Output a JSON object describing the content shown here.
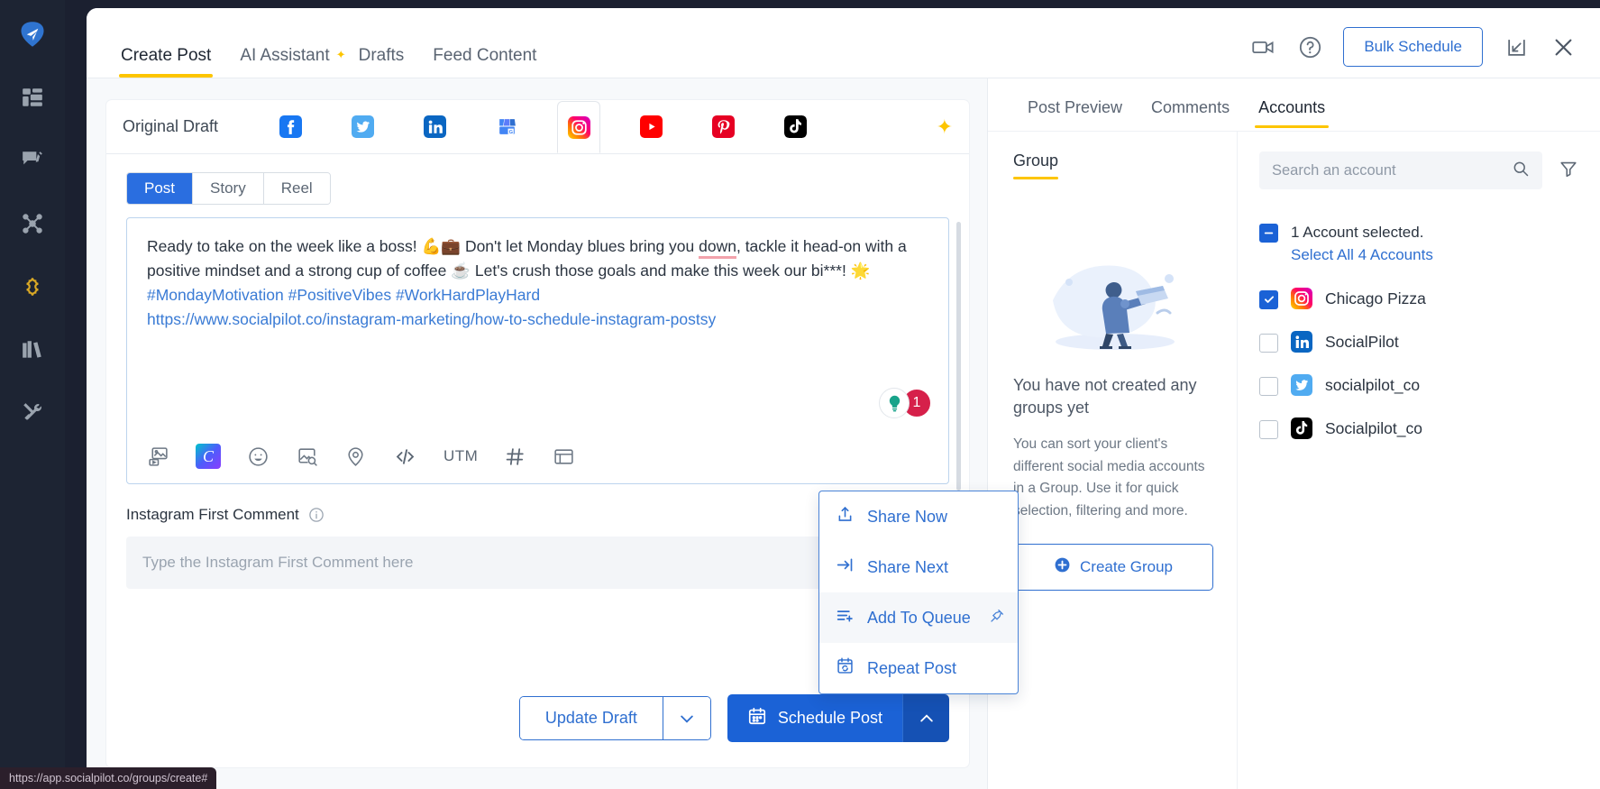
{
  "rail": {
    "items": [
      {
        "name": "logo",
        "icon": "paper-plane-logo"
      },
      {
        "name": "dashboard",
        "icon": "dashboard-grid-icon"
      },
      {
        "name": "inbox",
        "icon": "comment-edit-icon"
      },
      {
        "name": "network",
        "icon": "network-nodes-icon"
      },
      {
        "name": "campaigns",
        "icon": "diamond-star-icon"
      },
      {
        "name": "library",
        "icon": "books-icon"
      },
      {
        "name": "tools",
        "icon": "tools-wrench-icon"
      }
    ]
  },
  "header": {
    "tabs": [
      {
        "label": "Create Post",
        "active": true,
        "sparkle": false
      },
      {
        "label": "AI Assistant",
        "active": false,
        "sparkle": true
      },
      {
        "label": "Drafts",
        "active": false,
        "sparkle": false
      },
      {
        "label": "Feed Content",
        "active": false,
        "sparkle": false
      }
    ],
    "video_icon": "video-camera-icon",
    "help_icon": "question-circle-icon",
    "bulk_schedule_label": "Bulk Schedule",
    "minimize_icon": "minimize-window-icon",
    "close_icon": "close-x-icon"
  },
  "editor": {
    "original_draft_label": "Original Draft",
    "platforms": [
      {
        "name": "facebook",
        "active": false
      },
      {
        "name": "twitter",
        "active": false
      },
      {
        "name": "linkedin",
        "active": false
      },
      {
        "name": "google-business",
        "active": false
      },
      {
        "name": "instagram",
        "active": true
      },
      {
        "name": "youtube",
        "active": false
      },
      {
        "name": "pinterest",
        "active": false
      },
      {
        "name": "tiktok",
        "active": false
      }
    ],
    "ai_sparkle_icon": "ai-sparkle-icon",
    "post_types": [
      {
        "label": "Post",
        "active": true
      },
      {
        "label": "Story",
        "active": false
      },
      {
        "label": "Reel",
        "active": false
      }
    ],
    "content": {
      "line1_a": "Ready to take on the week like a boss! ",
      "emoji1": "💪",
      "emoji2": "💼",
      "line1_b": " Don't let Monday blues bring you ",
      "misspelled_word": "down",
      "line1_c": ", tackle it head-on with a positive mindset and a strong cup of coffee ",
      "emoji3": "☕",
      "line1_d": " Let's crush those goals and make this week our bi***! ",
      "emoji4": "🌟",
      "hashtags": "#MondayMotivation #PositiveVibes #WorkHardPlayHard",
      "url": "https://www.socialpilot.co/instagram-marketing/how-to-schedule-instagram-postsy"
    },
    "badges": {
      "bulb_icon": "lightbulb-idea-icon",
      "count": "1"
    },
    "toolbar": [
      {
        "name": "media-gallery-icon",
        "label": ""
      },
      {
        "name": "canva-icon",
        "label": "C"
      },
      {
        "name": "emoji-icon",
        "label": ""
      },
      {
        "name": "image-search-icon",
        "label": ""
      },
      {
        "name": "location-pin-icon",
        "label": ""
      },
      {
        "name": "code-embed-icon",
        "label": ""
      },
      {
        "name": "utm-button",
        "label": "UTM"
      },
      {
        "name": "hashtag-icon",
        "label": ""
      },
      {
        "name": "template-icon",
        "label": ""
      }
    ],
    "first_comment": {
      "label": "Instagram First Comment",
      "info_icon": "info-circle-icon",
      "placeholder": "Type the Instagram First Comment here",
      "value": ""
    },
    "footer": {
      "update_draft_label": "Update Draft",
      "update_draft_caret_icon": "chevron-down-icon",
      "schedule_post_label": "Schedule Post",
      "schedule_calendar_icon": "calendar-icon",
      "schedule_caret_icon": "chevron-up-icon"
    },
    "schedule_menu": [
      {
        "label": "Share Now",
        "icon": "share-upload-icon",
        "highlight": false,
        "pin": false
      },
      {
        "label": "Share Next",
        "icon": "arrow-right-bar-icon",
        "highlight": false,
        "pin": false
      },
      {
        "label": "Add To Queue",
        "icon": "list-plus-icon",
        "highlight": true,
        "pin": true,
        "pin_icon": "pin-icon"
      },
      {
        "label": "Repeat Post",
        "icon": "calendar-repeat-icon",
        "highlight": false,
        "pin": false
      }
    ]
  },
  "right_panel": {
    "tabs": [
      {
        "label": "Post Preview",
        "active": false
      },
      {
        "label": "Comments",
        "active": false
      },
      {
        "label": "Accounts",
        "active": true
      }
    ],
    "group": {
      "tab_label": "Group",
      "illustration": "person-reading-illustration",
      "empty_title": "You have not created any groups yet",
      "empty_desc": "You can sort your client's different social media accounts in a Group. Use it for quick selection, filtering and more.",
      "create_group_label": "Create Group",
      "create_group_icon": "plus-circle-icon"
    },
    "accounts": {
      "search_placeholder": "Search an account",
      "search_value": "",
      "search_icon": "search-icon",
      "filter_icon": "filter-funnel-icon",
      "selected_text": "1 Account selected.",
      "select_all_label": "Select All 4 Accounts",
      "select_all_state": "indeterminate",
      "list": [
        {
          "name": "Chicago Pizza",
          "platform": "instagram",
          "checked": true
        },
        {
          "name": "SocialPilot",
          "platform": "linkedin",
          "checked": false
        },
        {
          "name": "socialpilot_co",
          "platform": "twitter",
          "checked": false
        },
        {
          "name": "Socialpilot_co",
          "platform": "tiktok",
          "checked": false
        }
      ]
    }
  },
  "status_bar": {
    "url": "https://app.socialpilot.co/groups/create#"
  },
  "colors": {
    "accent_yellow": "#fdc500",
    "primary_blue": "#1b62d6",
    "link_blue": "#2f6fd0",
    "rail_bg": "#1d2433",
    "badge_red": "#d6204a"
  }
}
